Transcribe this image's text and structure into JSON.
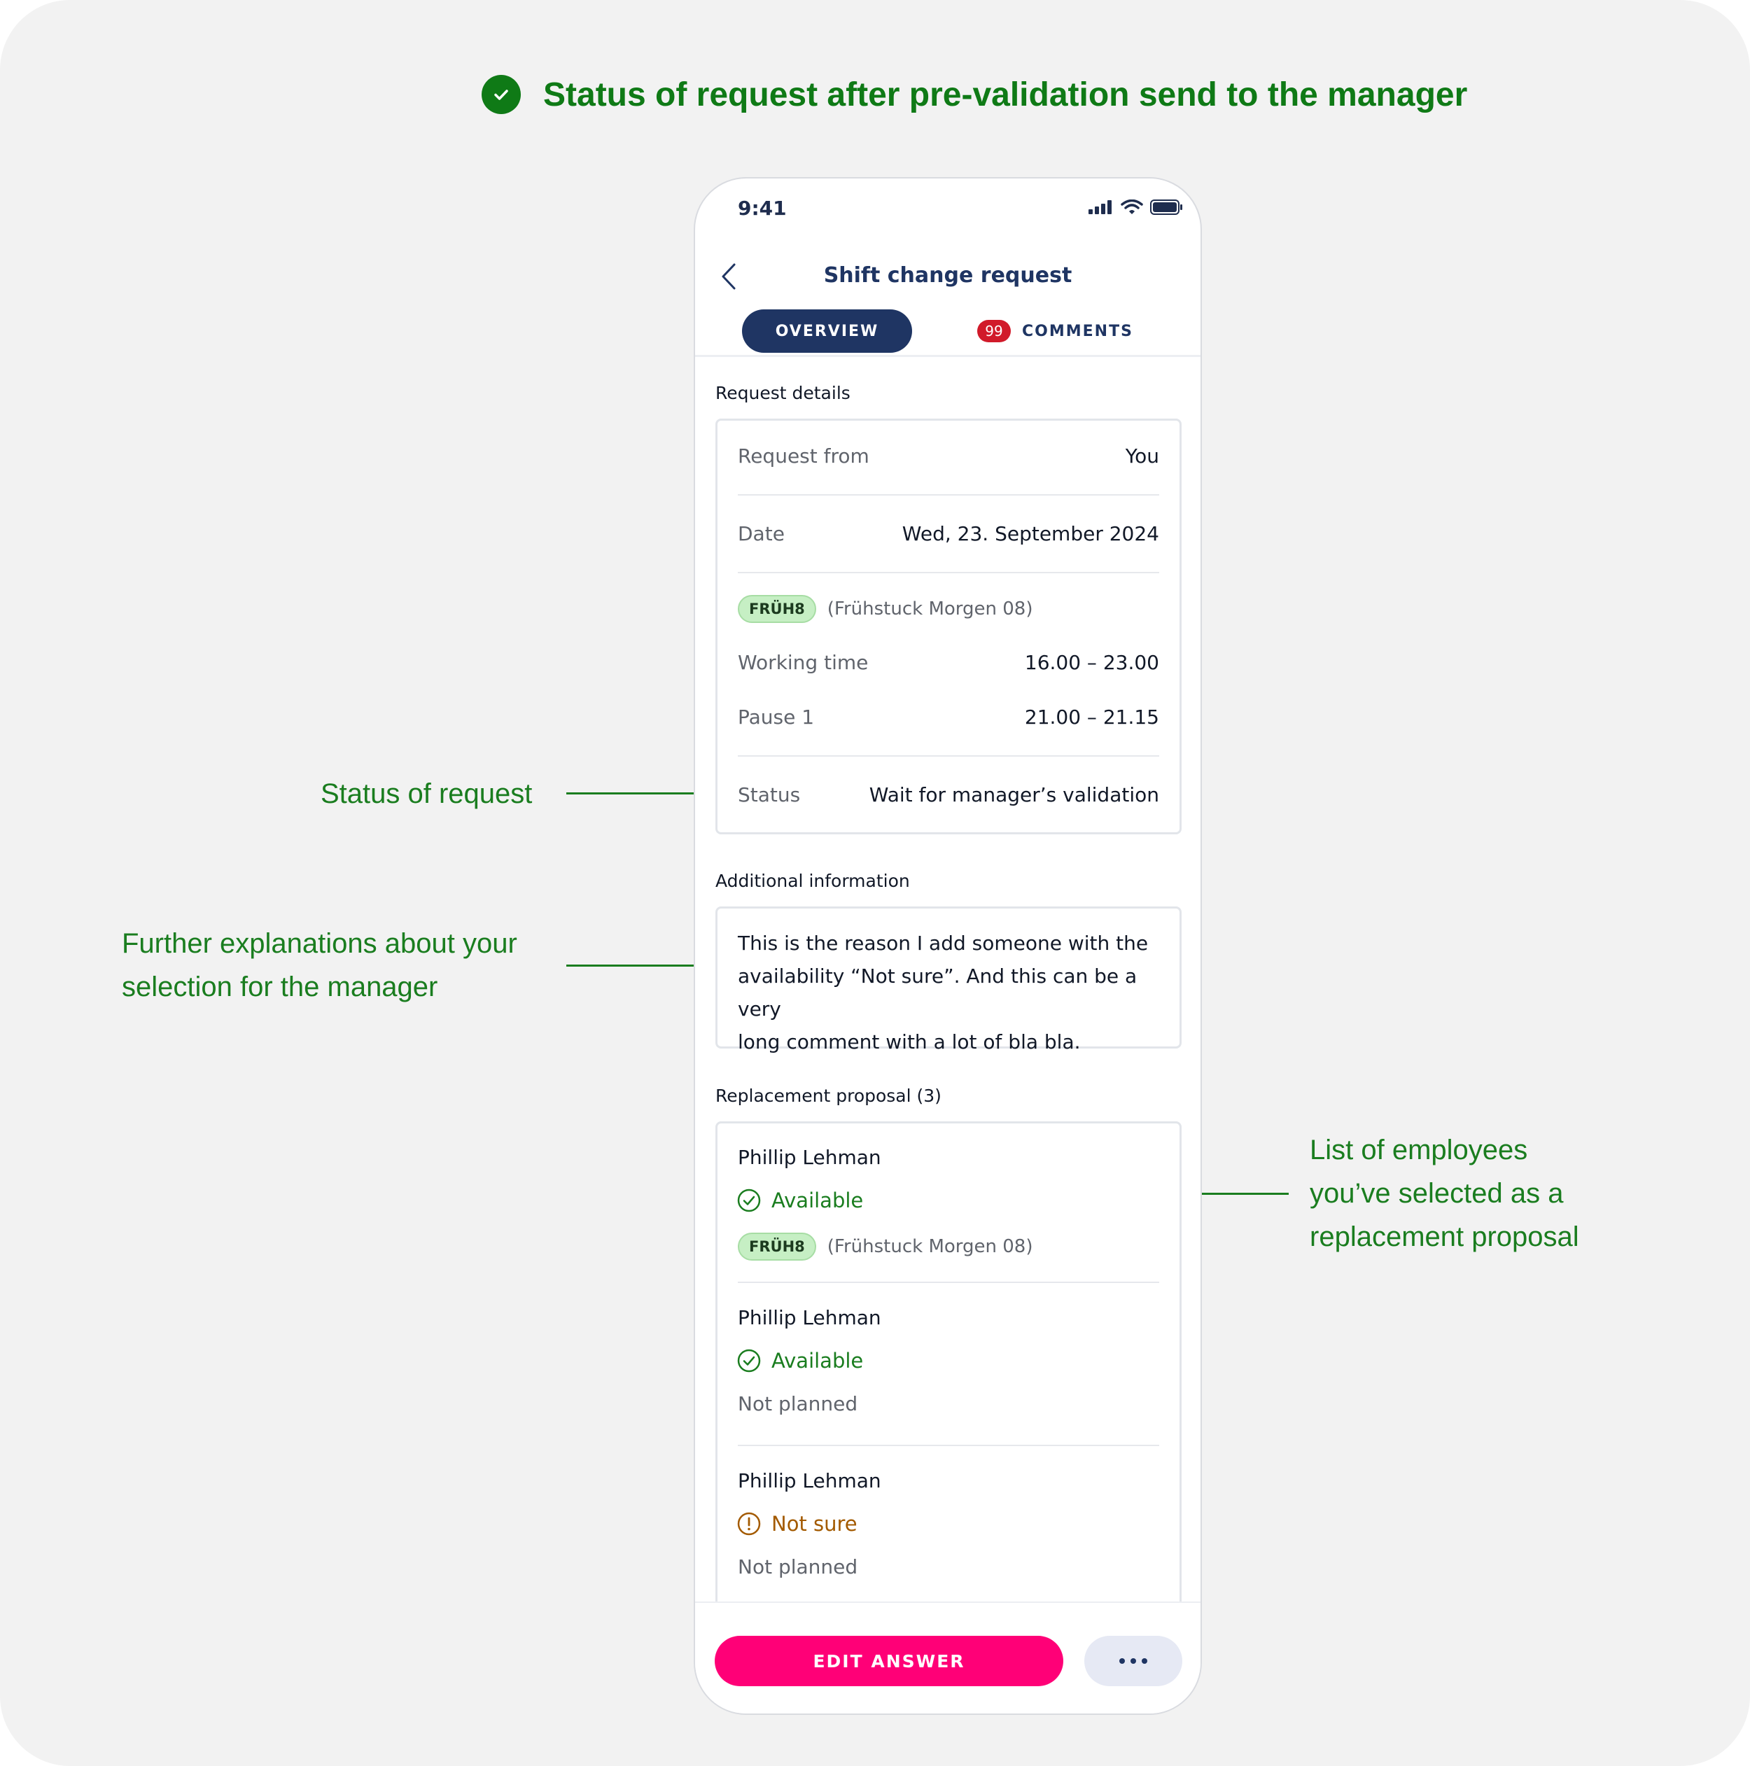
{
  "headline": {
    "text": "Status of request after pre-validation send to the manager",
    "icon": "check-circle-icon",
    "color": "#0f7a16"
  },
  "annotations": {
    "status": [
      "Status of request"
    ],
    "additional": [
      "Further explanations about your",
      "selection for the manager"
    ],
    "replacement": [
      "List of employees",
      "you’ve selected as a",
      "replacement proposal"
    ]
  },
  "phone": {
    "status_bar": {
      "time": "9:41",
      "icons": [
        "signal-icon",
        "wifi-icon",
        "battery-icon"
      ]
    },
    "nav": {
      "back_icon": "chevron-left-icon",
      "title": "Shift change request"
    },
    "tabs": {
      "overview": "OVERVIEW",
      "comments": "COMMENTS",
      "comments_badge": "99"
    },
    "request_details": {
      "label": "Request details",
      "request_from": {
        "key": "Request from",
        "value": "You"
      },
      "date": {
        "key": "Date",
        "value": "Wed, 23. September 2024"
      },
      "shift": {
        "code": "FRÜH8",
        "desc": "(Frühstuck Morgen 08)"
      },
      "working_time": {
        "key": "Working time",
        "value": "16.00 – 23.00"
      },
      "pause": {
        "key": "Pause 1",
        "value": "21.00 – 21.15"
      },
      "status": {
        "key": "Status",
        "value": "Wait for manager’s validation"
      }
    },
    "additional_info": {
      "label": "Additional information",
      "lines": [
        "This is the reason I add someone with the",
        "availability “Not sure”. And this can be a very",
        "long comment with a lot of bla bla."
      ]
    },
    "replacement": {
      "label": "Replacement proposal (3)",
      "items": [
        {
          "name": "Phillip Lehman",
          "availability": "Available",
          "shift_code": "FRÜH8",
          "shift_desc": "(Frühstuck Morgen 08)"
        },
        {
          "name": "Phillip Lehman",
          "availability": "Available",
          "plan": "Not planned"
        },
        {
          "name": "Phillip Lehman",
          "availability": "Not sure",
          "plan": "Not planned"
        }
      ]
    },
    "actions": {
      "edit": "EDIT ANSWER",
      "more_icon": "more-horizontal-icon"
    }
  },
  "colors": {
    "primary": "#1f3563",
    "accent": "#ff0077",
    "success": "#1a7d1f",
    "warning": "#a35a00",
    "badge": "#d11a2a"
  }
}
